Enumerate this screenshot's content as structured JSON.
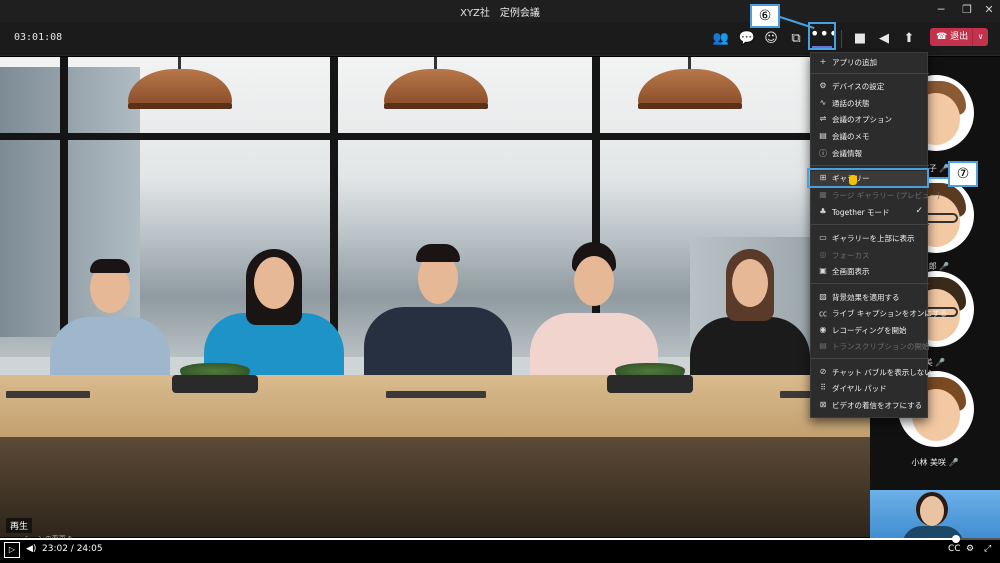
{
  "window": {
    "title": "XYZ社　定例会議",
    "minimize": "─",
    "maximize": "❐",
    "close": "✕"
  },
  "toolbar": {
    "timer": "03:01:08",
    "people_icon": "👥",
    "chat_icon": "💬",
    "reactions_icon": "☺",
    "share_icon": "⧉",
    "more_icon": "•••",
    "camera_icon": "■",
    "mic_icon": "◀",
    "share_screen_icon": "⬆",
    "leave_label": "☎ 退出",
    "leave_chevron": "∨"
  },
  "callouts": {
    "six": "⑥",
    "seven": "⑦"
  },
  "menu": {
    "items": [
      {
        "icon": "+",
        "label": "アプリの追加",
        "disabled": false
      },
      {
        "icon": "⚙",
        "label": "デバイスの設定",
        "disabled": false
      },
      {
        "icon": "∿",
        "label": "通話の状態",
        "disabled": false
      },
      {
        "icon": "⇌",
        "label": "会議のオプション",
        "disabled": false
      },
      {
        "icon": "▤",
        "label": "会議のメモ",
        "disabled": false
      },
      {
        "icon": "ⓘ",
        "label": "会議情報",
        "disabled": false
      },
      {
        "icon": "⊞",
        "label": "ギャラリー",
        "disabled": false
      },
      {
        "icon": "▦",
        "label": "ラージ ギャラリー (プレビュー)",
        "disabled": true
      },
      {
        "icon": "♣",
        "label": "Together モード",
        "disabled": false,
        "checked": true
      },
      {
        "icon": "▭",
        "label": "ギャラリーを上部に表示",
        "disabled": false
      },
      {
        "icon": "◎",
        "label": "フォーカス",
        "disabled": true
      },
      {
        "icon": "▣",
        "label": "全画面表示",
        "disabled": false
      },
      {
        "icon": "▨",
        "label": "背景効果を適用する",
        "disabled": false
      },
      {
        "icon": "㏄",
        "label": "ライブ キャプションをオンにする",
        "disabled": false
      },
      {
        "icon": "◉",
        "label": "レコーディングを開始",
        "disabled": false
      },
      {
        "icon": "▤",
        "label": "トランスクリプションの開始",
        "disabled": true
      },
      {
        "icon": "⊘",
        "label": "チャット バブルを表示しない",
        "disabled": false
      },
      {
        "icon": "⠿",
        "label": "ダイヤル パッド",
        "disabled": false
      },
      {
        "icon": "⊠",
        "label": "ビデオの着信をオフにする",
        "disabled": false
      }
    ],
    "check_mark": "✓"
  },
  "participants": [
    {
      "name": "花子"
    },
    {
      "name": "次郎"
    },
    {
      "name": "美"
    },
    {
      "name": "小林 美咲"
    }
  ],
  "mic_mark": "🎤",
  "player": {
    "caption": "再生",
    "scene_label": "シーンの変更 ✎",
    "play_icon": "▷",
    "volume_icon": "◀)",
    "time": "23:02 / 24:05",
    "progress": 0.956,
    "settings_icon": "⚙",
    "cc_icon": "CC",
    "fullscreen_icon": "⤢"
  }
}
